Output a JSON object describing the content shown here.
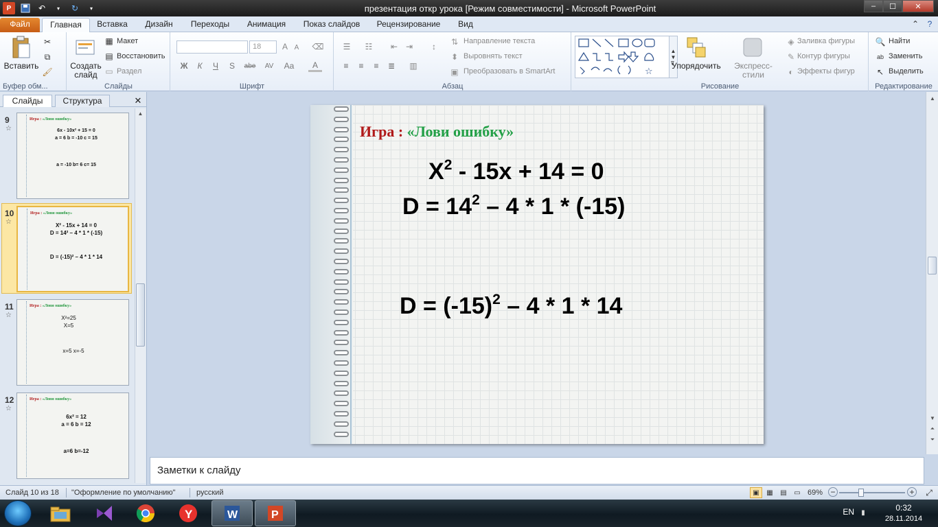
{
  "window": {
    "title": "презентация откр урока [Режим совместимости]  -  Microsoft PowerPoint",
    "controls": {
      "minimize": "–",
      "maximize": "☐",
      "close": "✕"
    }
  },
  "quick_access": {
    "save_icon": "save-icon",
    "undo_icon": "undo-icon",
    "redo_icon": "repeat-icon"
  },
  "tabs": [
    "Файл",
    "Главная",
    "Вставка",
    "Дизайн",
    "Переходы",
    "Анимация",
    "Показ слайдов",
    "Рецензирование",
    "Вид"
  ],
  "ribbon": {
    "clipboard": {
      "paste": "Вставить",
      "group": "Буфер обм..."
    },
    "slides": {
      "new_slide": "Создать",
      "new_slide2": "слайд",
      "layout": "Макет",
      "reset": "Восстановить",
      "section": "Раздел",
      "group": "Слайды"
    },
    "font": {
      "font_name": "",
      "font_size": "18",
      "bold": "Ж",
      "italic": "К",
      "underline": "Ч",
      "shadow": "S",
      "strike": "abe",
      "spacing": "AV",
      "case": "Aa",
      "color": "A",
      "grow": "A",
      "shrink": "A",
      "group": "Шрифт"
    },
    "paragraph": {
      "text_direction": "Направление текста",
      "align_text": "Выровнять текст",
      "smartart": "Преобразовать в SmartArt",
      "group": "Абзац"
    },
    "drawing": {
      "arrange": "Упорядочить",
      "quick_styles": "Экспресс-стили",
      "fill": "Заливка фигуры",
      "outline": "Контур фигуры",
      "effects": "Эффекты фигур",
      "group": "Рисование"
    },
    "editing": {
      "find": "Найти",
      "replace": "Заменить",
      "select": "Выделить",
      "group": "Редактирование"
    }
  },
  "panel": {
    "tab_slides": "Слайды",
    "tab_outline": "Структура",
    "close": "✕"
  },
  "thumbnails": [
    {
      "num": "9",
      "title_red": "Игра :",
      "title_green": "«Лови ошибку»",
      "lines": [
        "6x - 10x² + 15 = 0",
        "a = 6    b = -10   c = 15",
        "a = -10    b= 6      c= 15"
      ]
    },
    {
      "num": "10",
      "title_red": "Игра :",
      "title_green": "«Лови ошибку»",
      "lines": [
        "X² - 15x + 14 = 0",
        "D = 14² – 4 * 1 * (-15)",
        "D = (-15)² – 4 * 1 * 14"
      ]
    },
    {
      "num": "11",
      "title_red": "Игра :",
      "title_green": "«Лови ошибку»",
      "lines": [
        "X²=25",
        "X=5",
        "x=5  x=-5"
      ]
    },
    {
      "num": "12",
      "title_red": "Игра :",
      "title_green": "«Лови ошибку»",
      "lines": [
        "6x²  = 12",
        "a = 6    b = 12",
        "a=6  b=-12"
      ]
    }
  ],
  "slide": {
    "title_red": "Игра :",
    "title_green": "«Лови ошибку»",
    "eq1_a": "X",
    "eq1_sup": "2",
    "eq1_b": " - 15x + 14 = 0",
    "eq2_a": "D = 14",
    "eq2_sup": "2",
    "eq2_b": " – 4 * 1 * (-15)",
    "eq3_a": "D = (-15)",
    "eq3_sup": "2",
    "eq3_b": " – 4 * 1 * 14"
  },
  "notes": {
    "placeholder": "Заметки к слайду"
  },
  "status": {
    "slide_pos": "Слайд 10 из 18",
    "theme": "\"Оформление по умолчанию\"",
    "lang": "русский",
    "zoom": "69%",
    "zoom_level": 0.69
  },
  "taskbar": {
    "lang": "EN",
    "time": "0:32",
    "date": "28.11.2014",
    "apps": [
      "explorer-icon",
      "visual-studio-icon",
      "chrome-icon",
      "yandex-browser-icon",
      "word-icon",
      "powerpoint-icon"
    ]
  },
  "colors": {
    "accent_file_tab": "#d4691f",
    "title_red": "#b11a1a",
    "title_green": "#23a047",
    "selected_thumb": "#e8b642"
  }
}
